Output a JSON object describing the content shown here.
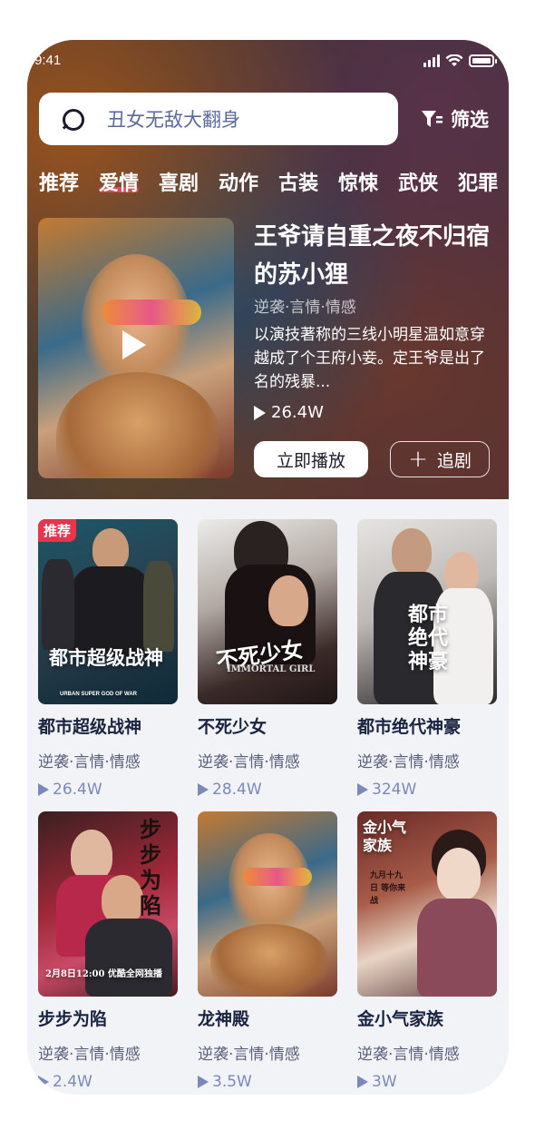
{
  "status_bar": {
    "time": "9:41"
  },
  "search": {
    "placeholder": "丑女无敌大翻身"
  },
  "filter": {
    "label": "筛选"
  },
  "tabs": [
    {
      "label": "推荐"
    },
    {
      "label": "爱情",
      "active": true
    },
    {
      "label": "喜剧"
    },
    {
      "label": "动作"
    },
    {
      "label": "古装"
    },
    {
      "label": "惊悚"
    },
    {
      "label": "武侠"
    },
    {
      "label": "犯罪"
    }
  ],
  "featured": {
    "title": "王爷请自重之夜不归宿的苏小狸",
    "tags": "逆袭·言情·情感",
    "description": "以演技著称的三线小明星温如意穿越成了个王府小妾。定王爷是出了名的残暴...",
    "plays": "26.4W",
    "play_label": "立即播放",
    "follow_label": "追剧"
  },
  "dramas": [
    {
      "title": "都市超级战神",
      "tags": "逆袭·言情·情感",
      "plays": "26.4W",
      "badge": "推荐",
      "cover_text": "都市超级战神",
      "cover_subtext": "URBAN SUPER GOD OF WAR"
    },
    {
      "title": "不死少女",
      "tags": "逆袭·言情·情感",
      "plays": "28.4W",
      "cover_text": "不死少女",
      "cover_subtext": "IMMORTAL GIRL"
    },
    {
      "title": "都市绝代神豪",
      "tags": "逆袭·言情·情感",
      "plays": "324W",
      "cover_text": "都市绝代神豪"
    },
    {
      "title": "步步为陷",
      "tags": "逆袭·言情·情感",
      "plays": "2.4W",
      "cover_text": "步步为陷",
      "cover_subtext": "2月8日12:00 优酷全网独播"
    },
    {
      "title": "龙神殿",
      "tags": "逆袭·言情·情感",
      "plays": "3.5W"
    },
    {
      "title": "金小气家族",
      "tags": "逆袭·言情·情感",
      "plays": "3W",
      "cover_text": "金小气家族",
      "cover_subtext": "九月十九日 等你来战"
    }
  ],
  "colors": {
    "accent": "#e2475a",
    "badge": "#e8344c",
    "title_dark": "#1a2340",
    "play_count": "#7a89b8"
  }
}
